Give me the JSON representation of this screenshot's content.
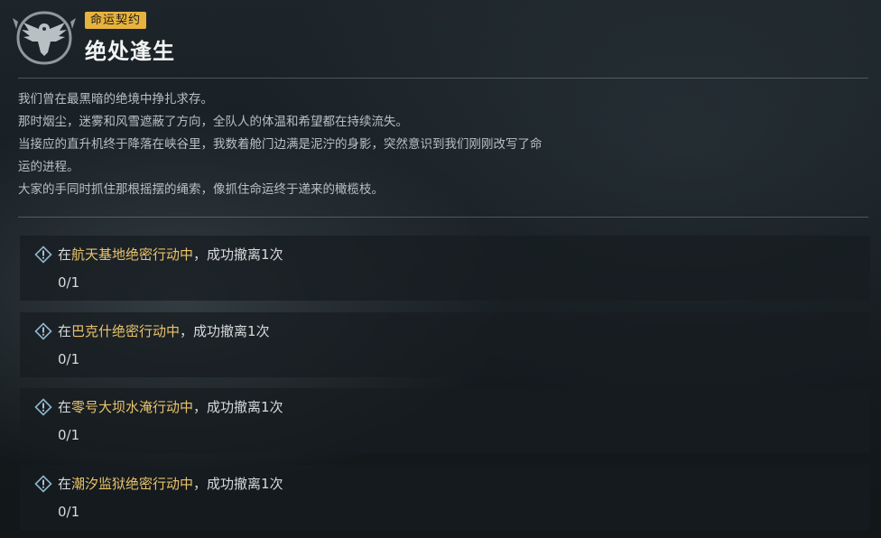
{
  "header": {
    "tag": "命运契约",
    "title": "绝处逢生"
  },
  "description": [
    "我们曾在最黑暗的绝境中挣扎求存。",
    "那时烟尘，迷雾和风雪遮蔽了方向，全队人的体温和希望都在持续流失。",
    "当接应的直升机终于降落在峡谷里，我数着舱门边满是泥泞的身影，突然意识到我们刚刚改写了命",
    "运的进程。",
    "大家的手同时抓住那根摇摆的绳索，像抓住命运终于递来的橄榄枝。"
  ],
  "tasks": [
    {
      "prefix": "在",
      "highlight": "航天基地绝密行动中",
      "suffix": "，成功撤离1次",
      "progress": "0/1"
    },
    {
      "prefix": "在",
      "highlight": "巴克什绝密行动中",
      "suffix": "，成功撤离1次",
      "progress": "0/1"
    },
    {
      "prefix": "在",
      "highlight": "零号大坝水淹行动中",
      "suffix": "，成功撤离1次",
      "progress": "0/1"
    },
    {
      "prefix": "在",
      "highlight": "潮汐监狱绝密行动中",
      "suffix": "，成功撤离1次",
      "progress": "0/1"
    }
  ],
  "icons": {
    "emblem": "eagle-emblem-icon",
    "task": "exclamation-diamond-icon"
  },
  "colors": {
    "accent": "#e7b33f",
    "highlight_text": "#e9c36b"
  }
}
